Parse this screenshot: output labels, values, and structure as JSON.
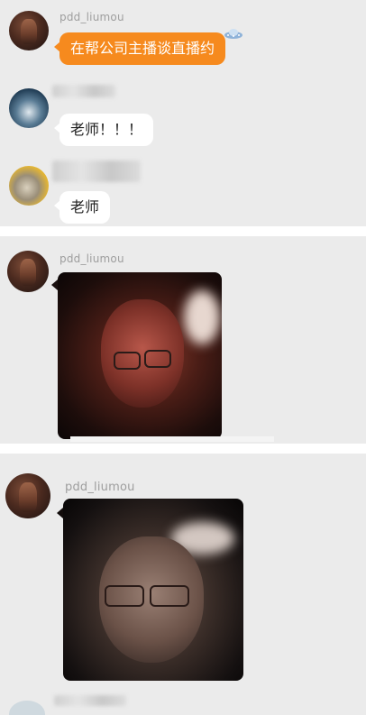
{
  "panels": [
    {
      "messages": [
        {
          "username": "pdd_liumou",
          "text": "在帮公司主播谈直播约",
          "style": "orange",
          "avatar": "muscle-avatar"
        },
        {
          "username": "",
          "text": "老师！！！",
          "style": "white",
          "avatar": "wave-avatar"
        },
        {
          "username": "",
          "text": "老师",
          "style": "white",
          "avatar": "yellow-avatar"
        }
      ]
    },
    {
      "messages": [
        {
          "username": "pdd_liumou",
          "type": "photo",
          "avatar": "muscle-avatar",
          "photo": "selfie-photo-red"
        }
      ]
    },
    {
      "messages": [
        {
          "username": "pdd_liumou",
          "type": "photo",
          "avatar": "muscle-avatar",
          "photo": "selfie-photo-dark"
        }
      ]
    }
  ],
  "colors": {
    "orange_bubble": "#f68a1e",
    "background": "#ebebeb",
    "username": "#9e9e9e"
  },
  "icons": [
    "ufo-sticker-icon"
  ]
}
